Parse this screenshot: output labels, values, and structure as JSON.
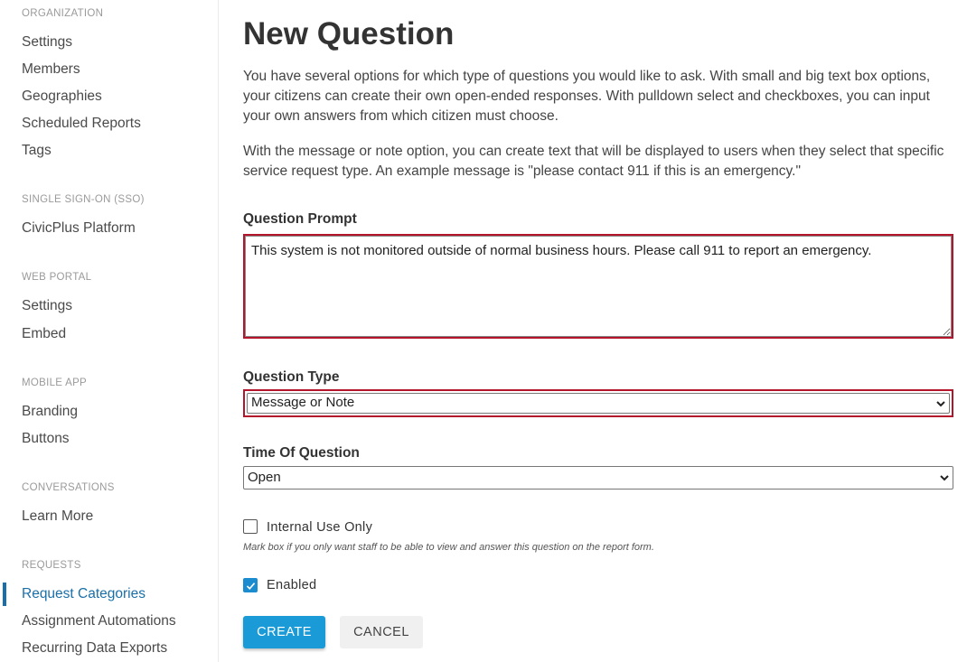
{
  "sidebar": {
    "sections": [
      {
        "heading": "ORGANIZATION",
        "items": [
          "Settings",
          "Members",
          "Geographies",
          "Scheduled Reports",
          "Tags"
        ]
      },
      {
        "heading": "SINGLE SIGN-ON (SSO)",
        "items": [
          "CivicPlus Platform"
        ]
      },
      {
        "heading": "WEB PORTAL",
        "items": [
          "Settings",
          "Embed"
        ]
      },
      {
        "heading": "MOBILE APP",
        "items": [
          "Branding",
          "Buttons"
        ]
      },
      {
        "heading": "CONVERSATIONS",
        "items": [
          "Learn More"
        ]
      },
      {
        "heading": "REQUESTS",
        "items": [
          "Request Categories",
          "Assignment Automations",
          "Recurring Data Exports"
        ]
      }
    ],
    "active_item": "Request Categories",
    "accent_color": "#1a6fa8"
  },
  "main": {
    "title": "New Question",
    "intro_paragraph_1": "You have several options for which type of questions you would like to ask. With small and big text box options, your citizens can create their own open-ended responses. With pulldown select and checkboxes, you can input your own answers from which citizen must choose.",
    "intro_paragraph_2": "With the message or note option, you can create text that will be displayed to users when they select that specific service request type. An example message is \"please contact 911 if this is an emergency.\"",
    "question_prompt": {
      "label": "Question Prompt",
      "value": "This system is not monitored outside of normal business hours. Please call 911 to report an emergency."
    },
    "question_type": {
      "label": "Question Type",
      "value": "Message or Note"
    },
    "time_of_question": {
      "label": "Time Of Question",
      "value": "Open"
    },
    "internal_use_only": {
      "label": "Internal Use Only",
      "checked": false,
      "hint": "Mark box if you only want staff to be able to view and answer this question on the report form."
    },
    "enabled": {
      "label": "Enabled",
      "checked": true
    },
    "buttons": {
      "create": "CREATE",
      "cancel": "CANCEL"
    },
    "highlight_color": "#b5152b",
    "primary_color": "#1a9bd7"
  }
}
